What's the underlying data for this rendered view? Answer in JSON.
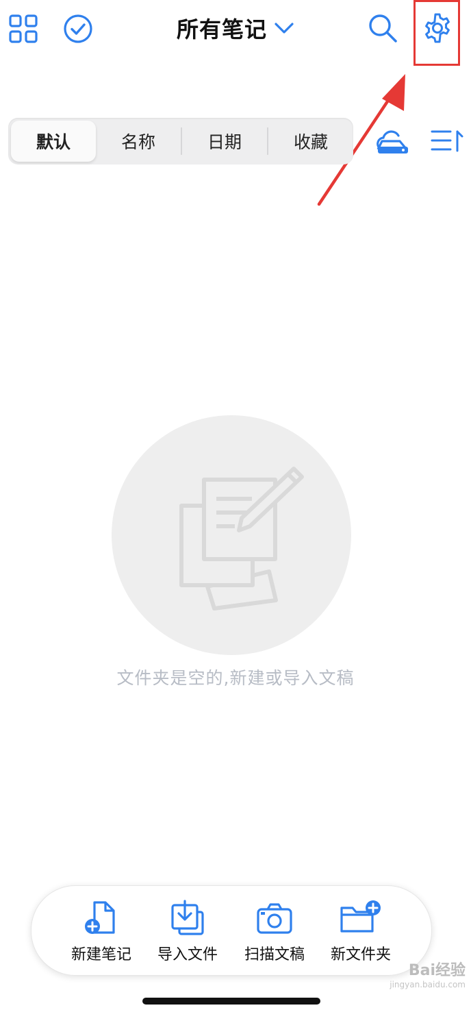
{
  "header": {
    "title": "所有笔记",
    "icons": [
      "grid-icon",
      "check-circle-icon",
      "chevron-down-icon",
      "search-icon",
      "gear-icon"
    ]
  },
  "sort_tabs": [
    {
      "label": "默认",
      "active": true
    },
    {
      "label": "名称",
      "active": false
    },
    {
      "label": "日期",
      "active": false
    },
    {
      "label": "收藏",
      "active": false
    }
  ],
  "sort_side_icons": [
    "cloud-drive-icon",
    "sort-order-icon"
  ],
  "empty_state": {
    "message": "文件夹是空的,新建或导入文稿",
    "icon": "note-pencil-illustration"
  },
  "toolbar": {
    "new_note": "新建笔记",
    "import_file": "导入文件",
    "scan_doc": "扫描文稿",
    "new_folder": "新文件夹"
  },
  "watermark": {
    "brand": "Bai经验",
    "url": "jingyan.baidu.com"
  },
  "colors": {
    "accent": "#2f80ed",
    "annotation": "#e53935",
    "empty_circle": "#eeeeee",
    "empty_text": "#b7bcc5"
  }
}
